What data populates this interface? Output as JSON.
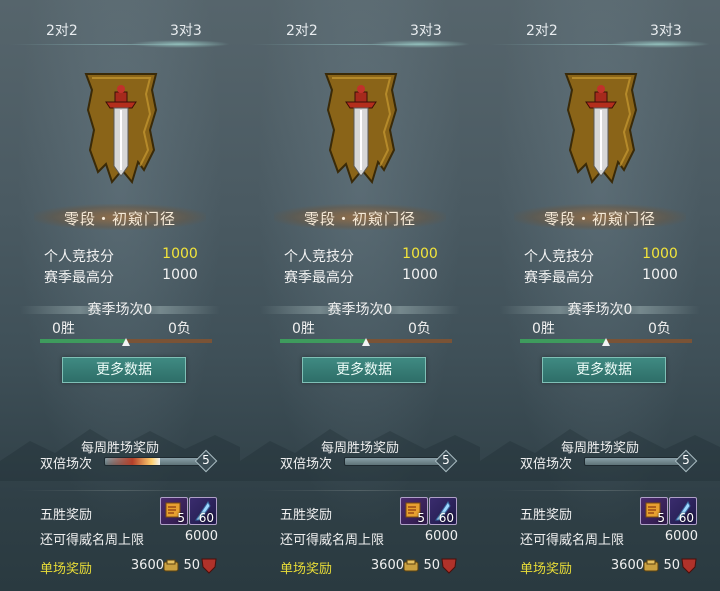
{
  "panels": [
    {
      "tabs": [
        "2对2",
        "3对3"
      ],
      "rank_name": "零段・初窥门径",
      "personal_score_label": "个人竞技分",
      "personal_score": "1000",
      "season_high_label": "赛季最高分",
      "season_high": "1000",
      "season_matches": "赛季场次0",
      "wins": "0胜",
      "losses": "0负",
      "win_ratio": 0.5,
      "more_button": "更多数据",
      "weekly_title": "每周胜场奖励",
      "double_label": "双倍场次",
      "double_count": "5",
      "double_progress": 0.55,
      "five_win_label": "五胜奖励",
      "reward_items": [
        {
          "icon": "scroll-icon",
          "count": "5"
        },
        {
          "icon": "feather-icon",
          "count": "60"
        }
      ],
      "limit_label": "还可得威名周上限",
      "limit_value": "6000",
      "single_label": "单场奖励",
      "single_coins": "3600",
      "single_shields": "50"
    },
    {
      "tabs": [
        "2对2",
        "3对3"
      ],
      "rank_name": "零段・初窥门径",
      "personal_score_label": "个人竞技分",
      "personal_score": "1000",
      "season_high_label": "赛季最高分",
      "season_high": "1000",
      "season_matches": "赛季场次0",
      "wins": "0胜",
      "losses": "0负",
      "win_ratio": 0.5,
      "more_button": "更多数据",
      "weekly_title": "每周胜场奖励",
      "double_label": "双倍场次",
      "double_count": "5",
      "double_progress": 0.0,
      "five_win_label": "五胜奖励",
      "reward_items": [
        {
          "icon": "scroll-icon",
          "count": "5"
        },
        {
          "icon": "feather-icon",
          "count": "60"
        }
      ],
      "limit_label": "还可得威名周上限",
      "limit_value": "6000",
      "single_label": "单场奖励",
      "single_coins": "3600",
      "single_shields": "50"
    },
    {
      "tabs": [
        "2对2",
        "3对3"
      ],
      "rank_name": "零段・初窥门径",
      "personal_score_label": "个人竞技分",
      "personal_score": "1000",
      "season_high_label": "赛季最高分",
      "season_high": "1000",
      "season_matches": "赛季场次0",
      "wins": "0胜",
      "losses": "0负",
      "win_ratio": 0.5,
      "more_button": "更多数据",
      "weekly_title": "每周胜场奖励",
      "double_label": "双倍场次",
      "double_count": "5",
      "double_progress": 0.0,
      "five_win_label": "五胜奖励",
      "reward_items": [
        {
          "icon": "scroll-icon",
          "count": "5"
        },
        {
          "icon": "feather-icon",
          "count": "60"
        }
      ],
      "limit_label": "还可得威名周上限",
      "limit_value": "6000",
      "single_label": "单场奖励",
      "single_coins": "3600",
      "single_shields": "50"
    }
  ],
  "colors": {
    "score_yellow": "#f4e53a",
    "win_green": "#3e9b5d",
    "loss_brown": "#7a5336",
    "button_teal": "#2e6e68",
    "single_reward_yellow": "#e8dc38"
  }
}
